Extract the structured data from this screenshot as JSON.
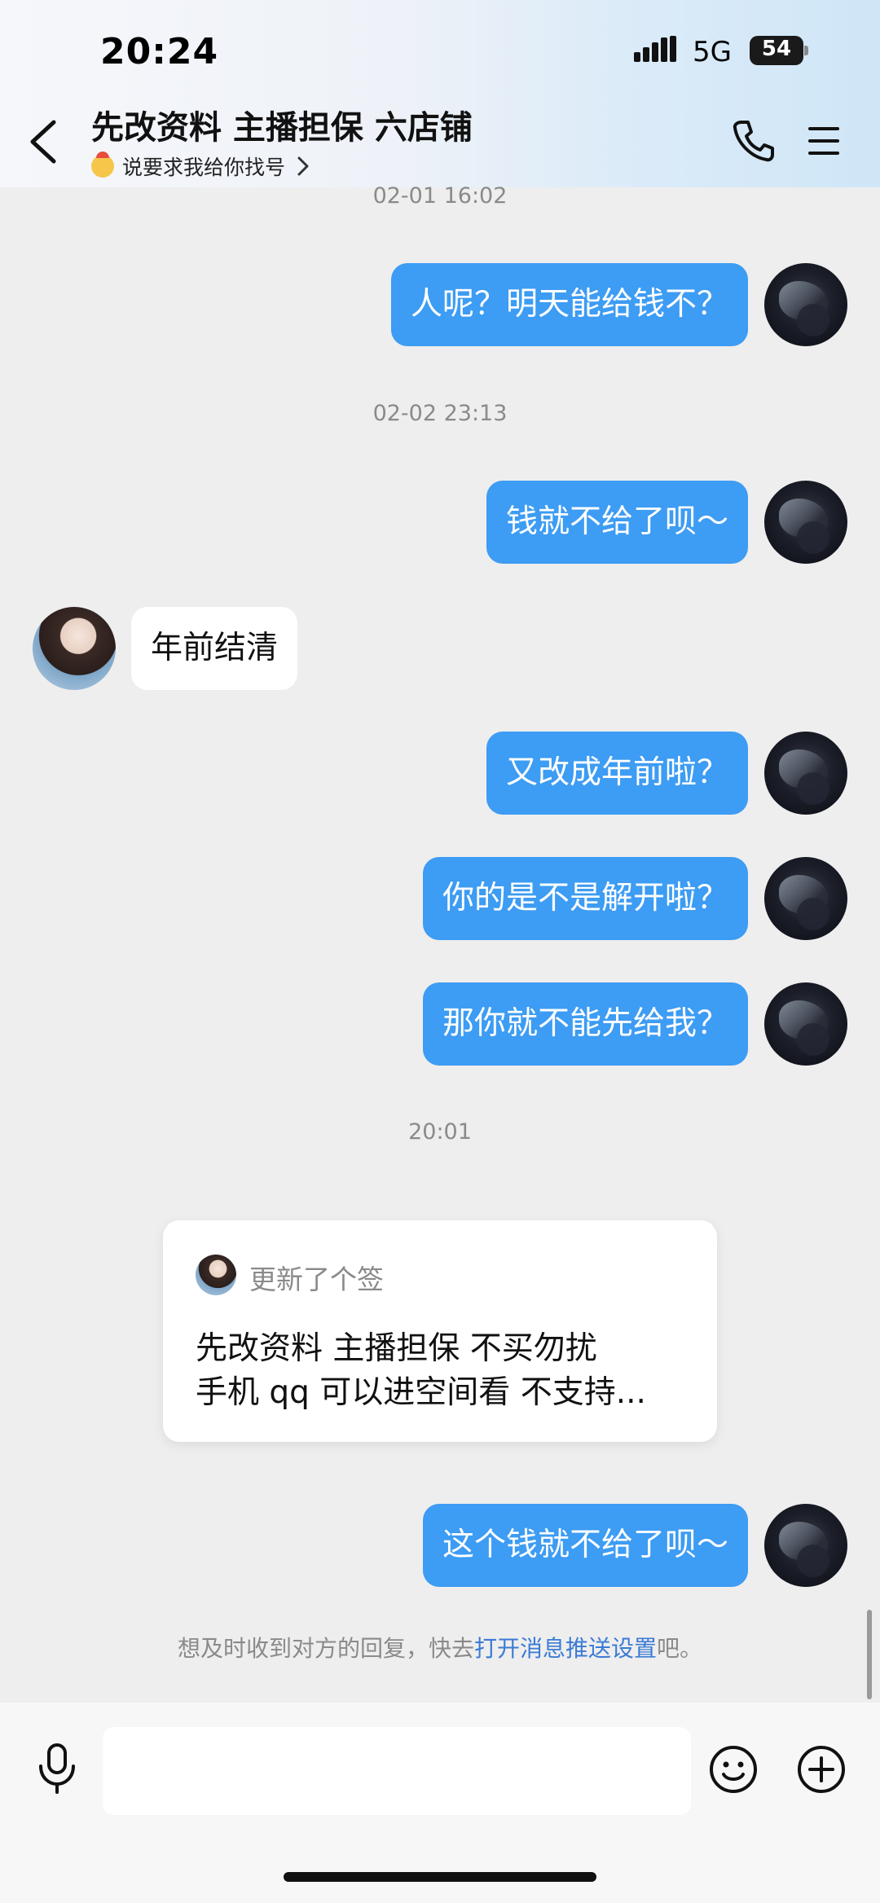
{
  "status_bar": {
    "time": "20:24",
    "network": "5G",
    "battery": "54"
  },
  "header": {
    "title": "先改资料 主播担保 六店铺",
    "subtitle": "说要求我给你找号"
  },
  "messages": {
    "time1": "02-01 16:02",
    "m1": "人呢？明天能给钱不？",
    "time2": "02-02 23:13",
    "m2": "钱就不给了呗～",
    "r1": "年前结清",
    "m3": "又改成年前啦？",
    "m4": "你的是不是解开啦？",
    "m5": "那你就不能先给我？",
    "time3": "20:01",
    "m6": "这个钱就不给了呗～"
  },
  "signature_card": {
    "header": "更新了个签",
    "line1": "先改资料 主播担保 不买勿扰",
    "line2": "手机 qq 可以进空间看 不支持..."
  },
  "notify": {
    "prefix": "想及时收到对方的回复，快去",
    "link": "打开消息推送设置",
    "suffix": "吧。"
  },
  "input": {
    "placeholder": ""
  }
}
